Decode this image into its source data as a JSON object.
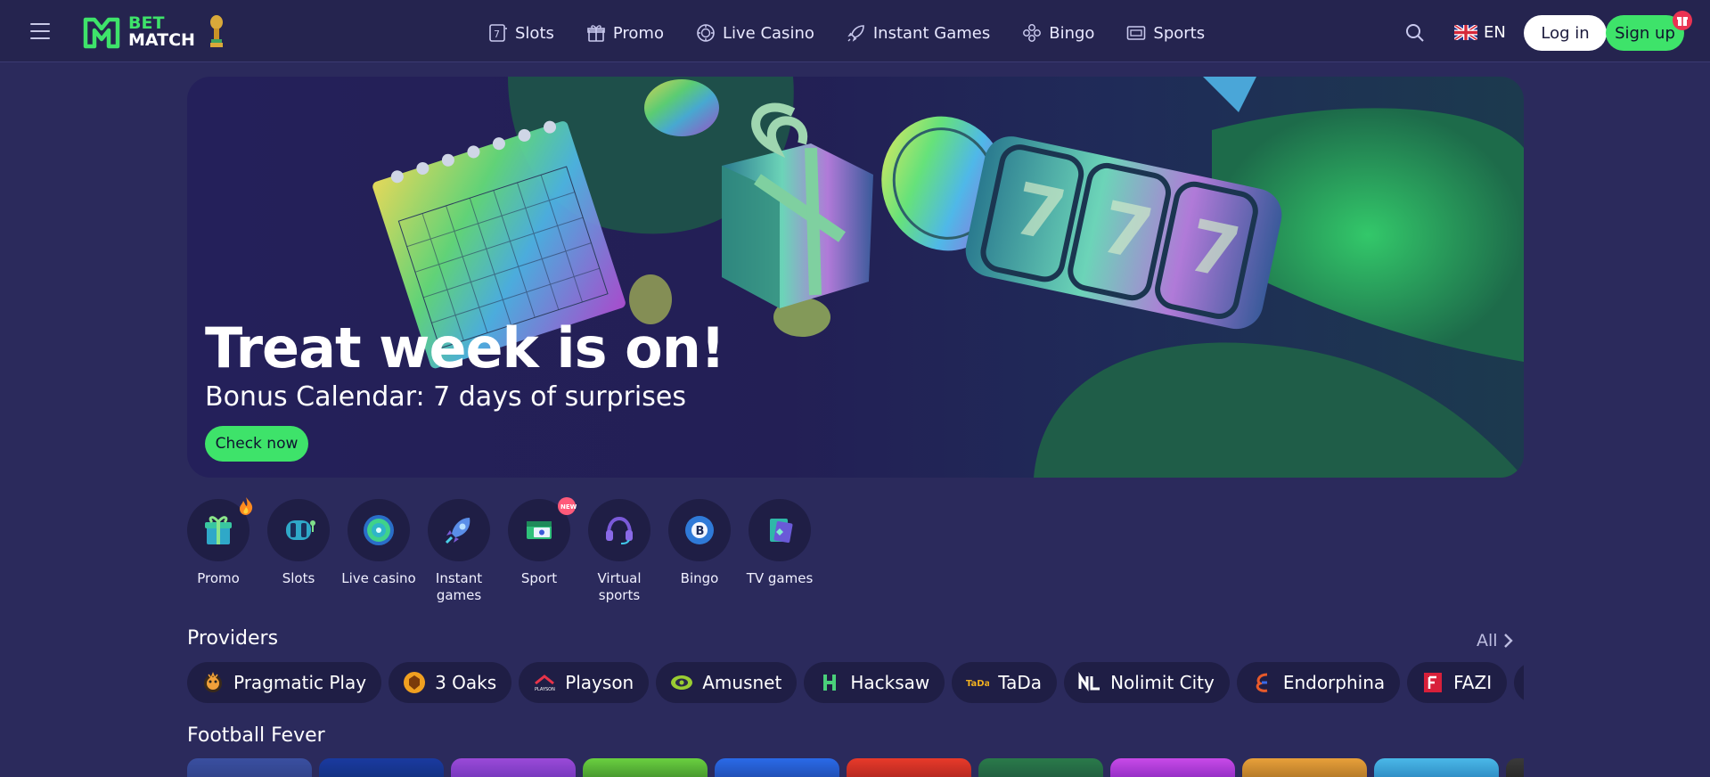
{
  "header": {
    "logo_line1": "BET",
    "logo_line2": "MATCH",
    "nav": [
      {
        "label": "Slots",
        "icon": "slot-machine-icon"
      },
      {
        "label": "Promo",
        "icon": "gift-icon"
      },
      {
        "label": "Live Casino",
        "icon": "chip-icon"
      },
      {
        "label": "Instant Games",
        "icon": "rocket-icon"
      },
      {
        "label": "Bingo",
        "icon": "bingo-icon"
      },
      {
        "label": "Sports",
        "icon": "ticket-icon"
      }
    ],
    "language": "EN",
    "login_label": "Log in",
    "signup_label": "Sign up"
  },
  "hero": {
    "title": "Treat week is on!",
    "subtitle": "Bonus Calendar: 7 days of surprises",
    "cta": "Check now"
  },
  "categories": [
    {
      "label": "Promo",
      "icon": "gift-icon",
      "badge": "fire-icon"
    },
    {
      "label": "Slots",
      "icon": "slot-reels-icon"
    },
    {
      "label": "Live casino",
      "icon": "roulette-icon"
    },
    {
      "label": "Instant games",
      "icon": "rocket-icon"
    },
    {
      "label": "Sport",
      "icon": "sport-ticket-icon",
      "badge": "new-badge"
    },
    {
      "label": "Virtual sports",
      "icon": "headset-icon"
    },
    {
      "label": "Bingo",
      "icon": "bingo-ball-icon"
    },
    {
      "label": "TV games",
      "icon": "tv-cards-icon"
    }
  ],
  "providers_section": {
    "title": "Providers",
    "all_label": "All",
    "items": [
      {
        "name": "Pragmatic Play"
      },
      {
        "name": "3 Oaks"
      },
      {
        "name": "Playson"
      },
      {
        "name": "Amusnet"
      },
      {
        "name": "Hacksaw"
      },
      {
        "name": "TaDa"
      },
      {
        "name": "Nolimit City"
      },
      {
        "name": "Endorphina"
      },
      {
        "name": "FAZI"
      },
      {
        "name": ""
      }
    ]
  },
  "football_section": {
    "title": "Football Fever"
  },
  "colors": {
    "accent": "#3ee36a",
    "background": "#2b2a5c",
    "header": "#25244f",
    "badge_red": "#ea3352"
  }
}
